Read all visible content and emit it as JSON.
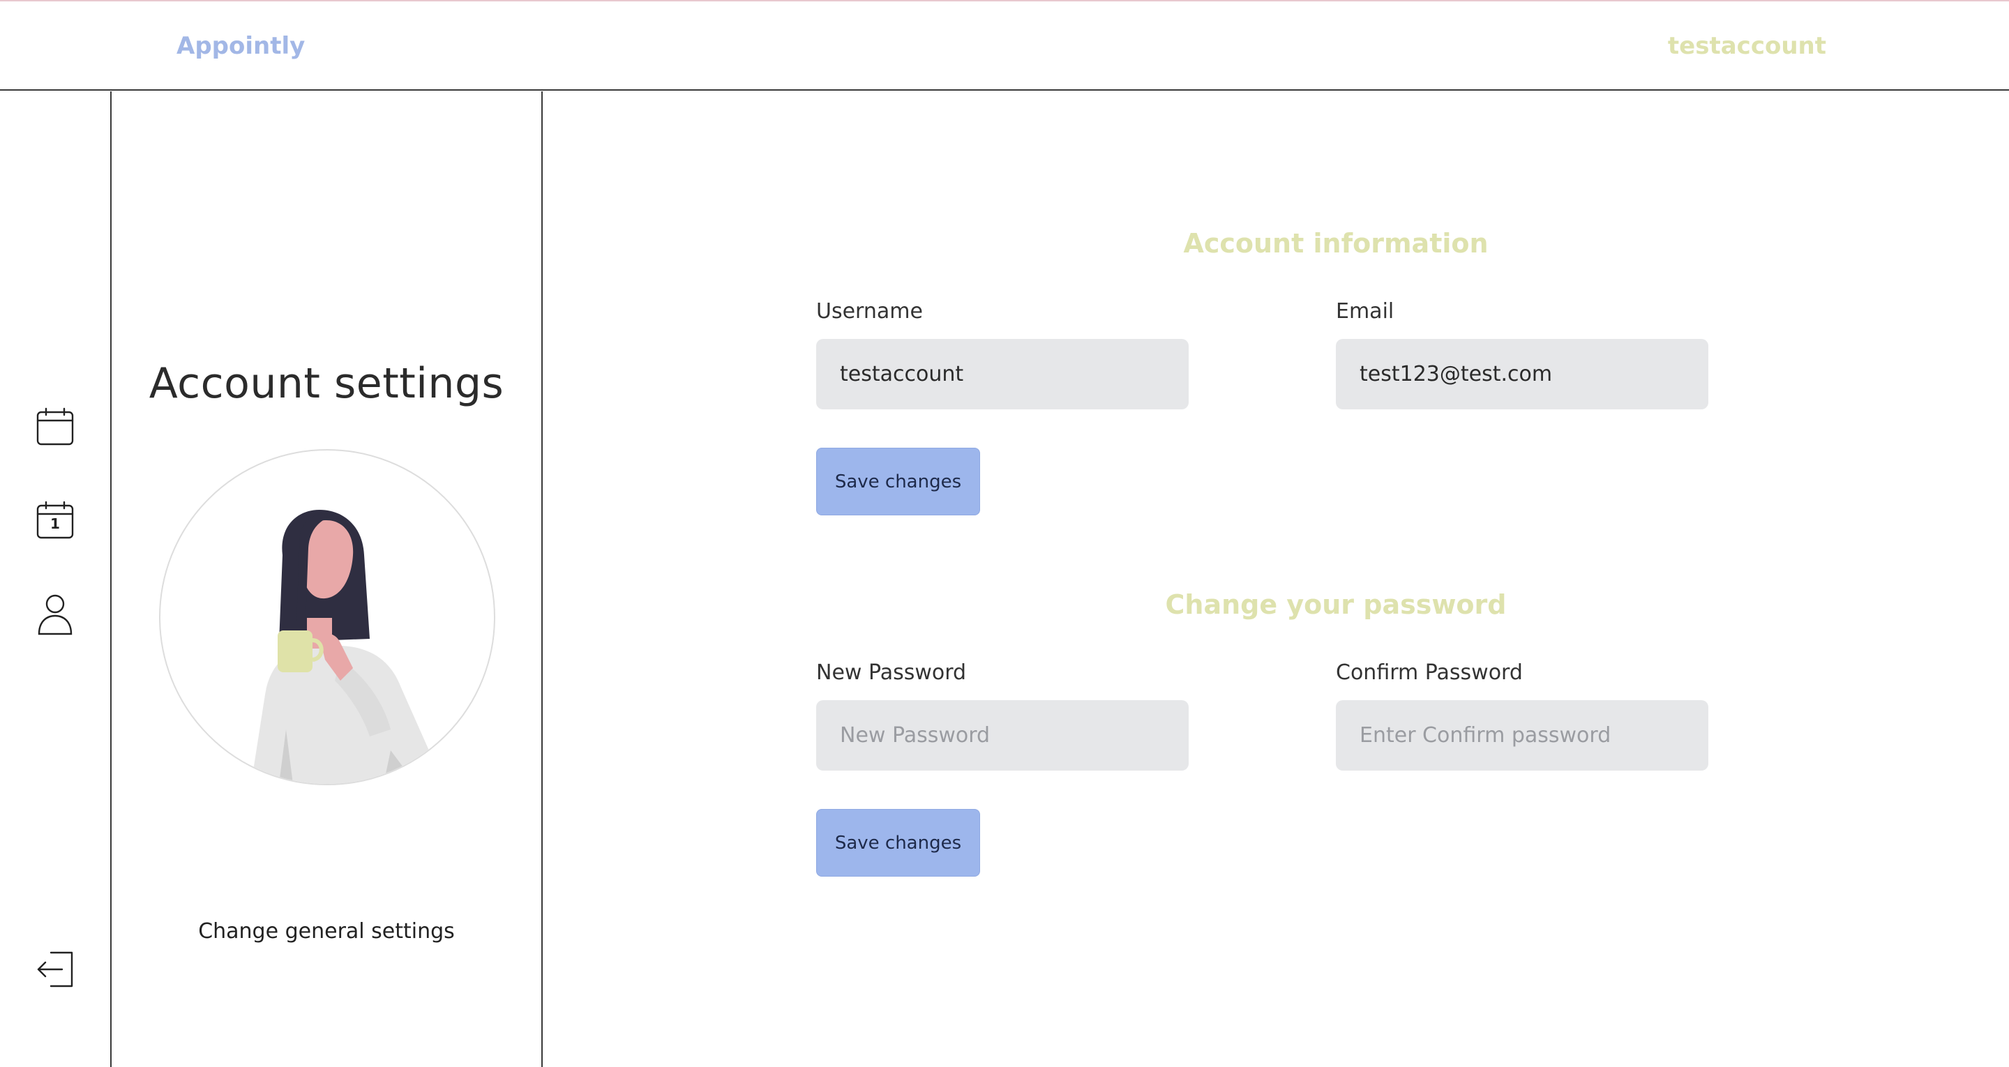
{
  "header": {
    "brand": "Appointly",
    "user": "testaccount"
  },
  "sidebar": {
    "items": [
      {
        "icon": "calendar-icon",
        "name": "calendar"
      },
      {
        "icon": "calendar-day-icon",
        "name": "calendar-day",
        "day_number": "1"
      },
      {
        "icon": "user-icon",
        "name": "account"
      }
    ],
    "logout_icon": "logout-icon"
  },
  "info_panel": {
    "title": "Account settings",
    "caption": "Change general settings"
  },
  "account_info": {
    "title": "Account information",
    "username_label": "Username",
    "username_value": "testaccount",
    "email_label": "Email",
    "email_value": "test123@test.com",
    "save_label": "Save changes"
  },
  "password": {
    "title": "Change your password",
    "new_label": "New Password",
    "new_placeholder": "New Password",
    "confirm_label": "Confirm Password",
    "confirm_placeholder": "Enter Confirm password",
    "save_label": "Save changes"
  },
  "colors": {
    "brand": "#a2b7e6",
    "accent_yellow": "#dee2ad",
    "button": "#9db6ec",
    "input_bg": "#e6e7e9"
  }
}
